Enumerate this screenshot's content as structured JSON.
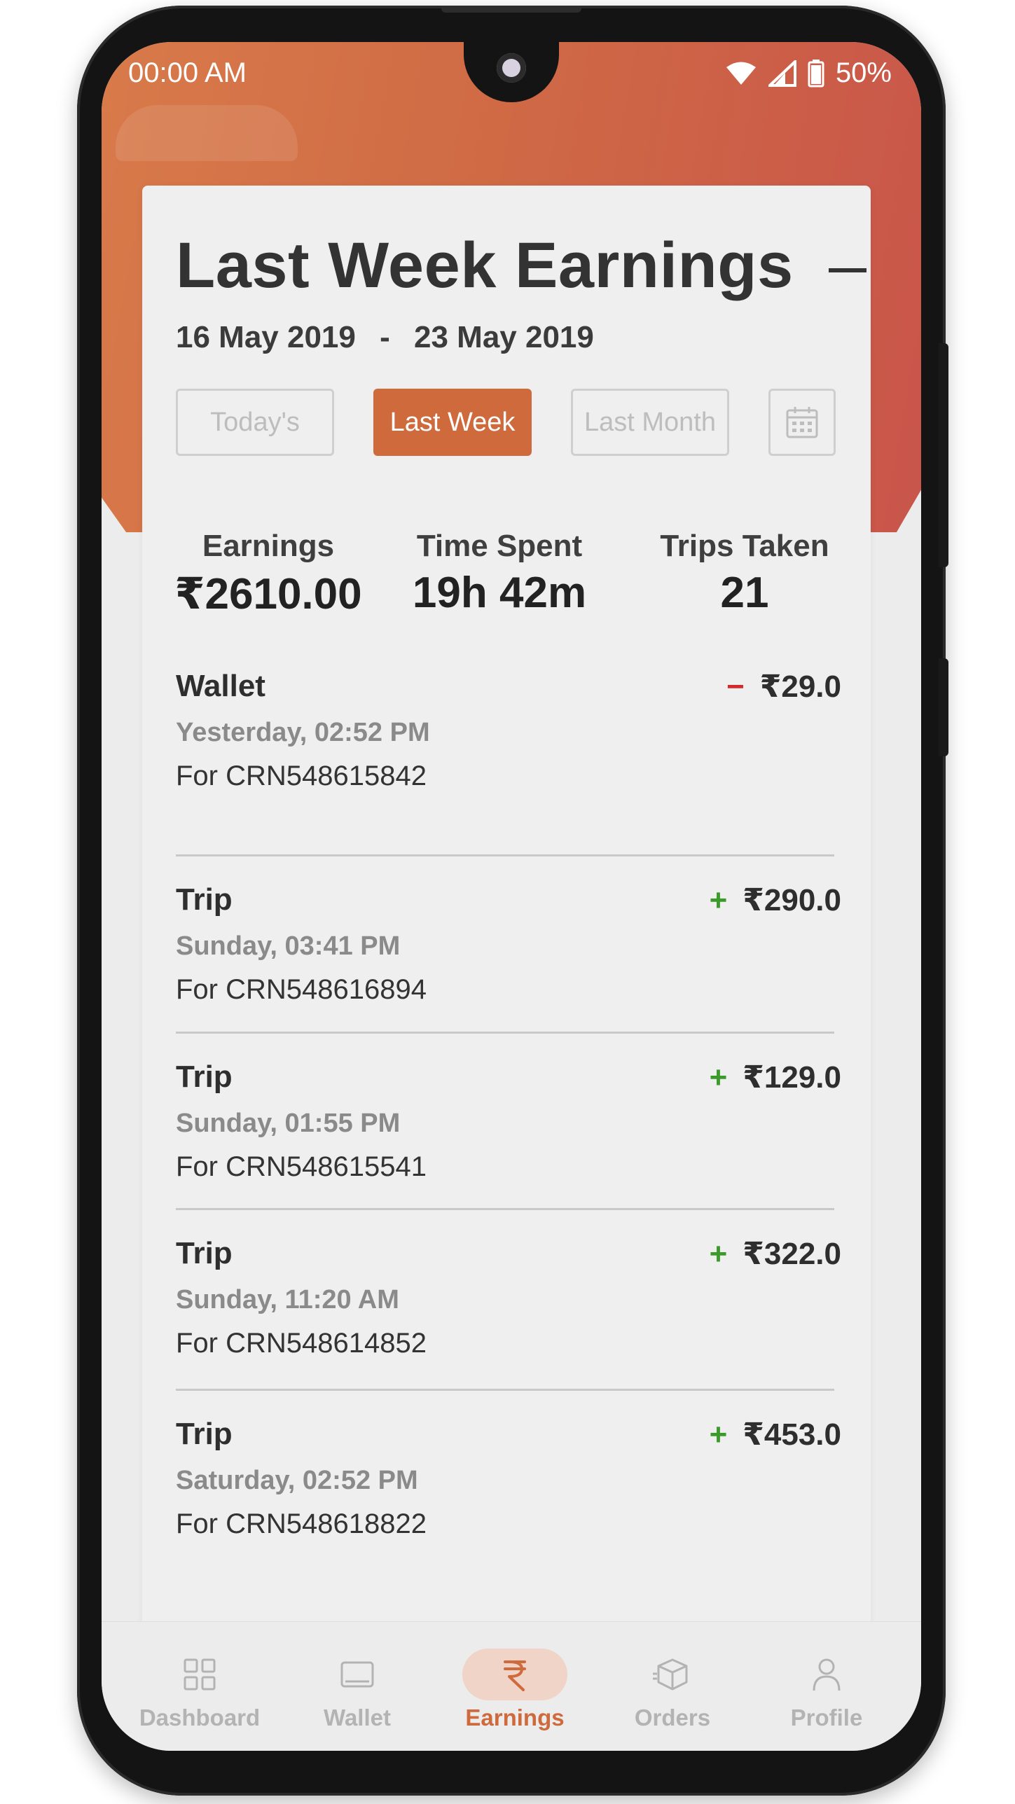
{
  "status_bar": {
    "time": "00:00 AM",
    "battery": "50%",
    "icons": [
      "wifi-icon",
      "signal-icon",
      "battery-icon"
    ]
  },
  "header": {
    "title": "Last Week Earnings",
    "date_from": "16 May 2019",
    "date_separator": "-",
    "date_to": "23 May 2019"
  },
  "filters": {
    "today_label": "Today's",
    "last_week_label": "Last Week",
    "last_month_label": "Last Month",
    "selected": "Last Week",
    "calendar_icon": "calendar-icon"
  },
  "summary": {
    "earnings_label": "Earnings",
    "earnings_value": "₹2610.00",
    "time_label": "Time Spent",
    "time_value": "19h 42m",
    "trips_label": "Trips Taken",
    "trips_value": "21"
  },
  "transactions": [
    {
      "type": "Wallet",
      "time": "Yesterday, 02:52 PM",
      "ref": "For CRN548615842",
      "sign": "−",
      "amount": "₹29.0"
    },
    {
      "type": "Trip",
      "time": "Sunday, 03:41 PM",
      "ref": "For CRN548616894",
      "sign": "+",
      "amount": "₹290.0"
    },
    {
      "type": "Trip",
      "time": "Sunday, 01:55 PM",
      "ref": "For CRN548615541",
      "sign": "+",
      "amount": "₹129.0"
    },
    {
      "type": "Trip",
      "time": "Sunday, 11:20 AM",
      "ref": "For CRN548614852",
      "sign": "+",
      "amount": "₹322.0"
    },
    {
      "type": "Trip",
      "time": "Saturday, 02:52 PM",
      "ref": "For CRN548618822",
      "sign": "+",
      "amount": "₹453.0"
    }
  ],
  "nav": {
    "dashboard": "Dashboard",
    "wallet": "Wallet",
    "earnings": "Earnings",
    "orders": "Orders",
    "profile": "Profile",
    "active": "Earnings"
  },
  "colors": {
    "accent": "#cf6a3c",
    "positive": "#3a9a2a",
    "negative": "#d22b2b"
  }
}
